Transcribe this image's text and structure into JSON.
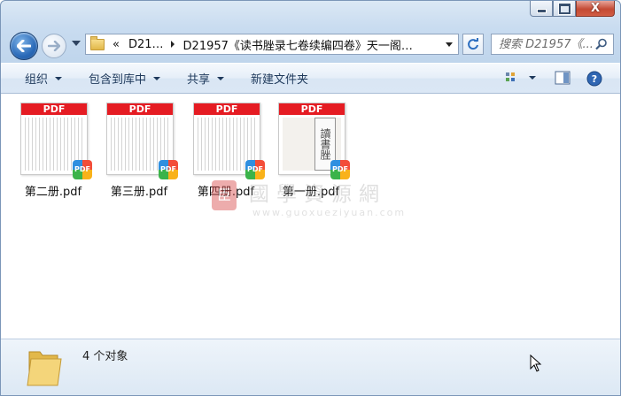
{
  "window": {
    "caption_buttons": {
      "minimize": "minimize",
      "maximize": "maximize",
      "close": "X"
    }
  },
  "nav": {
    "address": {
      "overflow_chevron": "«",
      "crumbs": [
        "D21…",
        "D21957《读书脞录七卷续编四卷》天一阁…"
      ]
    },
    "search_placeholder": "搜索 D21957《..."
  },
  "toolbar": {
    "organize": "组织",
    "include_in_library": "包含到库中",
    "share": "共享",
    "new_folder": "新建文件夹"
  },
  "files": [
    {
      "name": "第二册.pdf",
      "band": "PDF",
      "badge": "PDF"
    },
    {
      "name": "第三册.pdf",
      "band": "PDF",
      "badge": "PDF"
    },
    {
      "name": "第四册.pdf",
      "band": "PDF",
      "badge": "PDF"
    },
    {
      "name": "第一册.pdf",
      "band": "PDF",
      "badge": "PDF",
      "cover_text": "讀書脞"
    }
  ],
  "watermark": {
    "seal": "臣",
    "title": "國學資源網",
    "url": "www.guoxueziyuan.com"
  },
  "details": {
    "item_count": "4 个对象"
  },
  "colors": {
    "pdf_band": "#e51c23",
    "toolbar_text": "#1e395b",
    "window_frame": "#bfd5ec"
  }
}
